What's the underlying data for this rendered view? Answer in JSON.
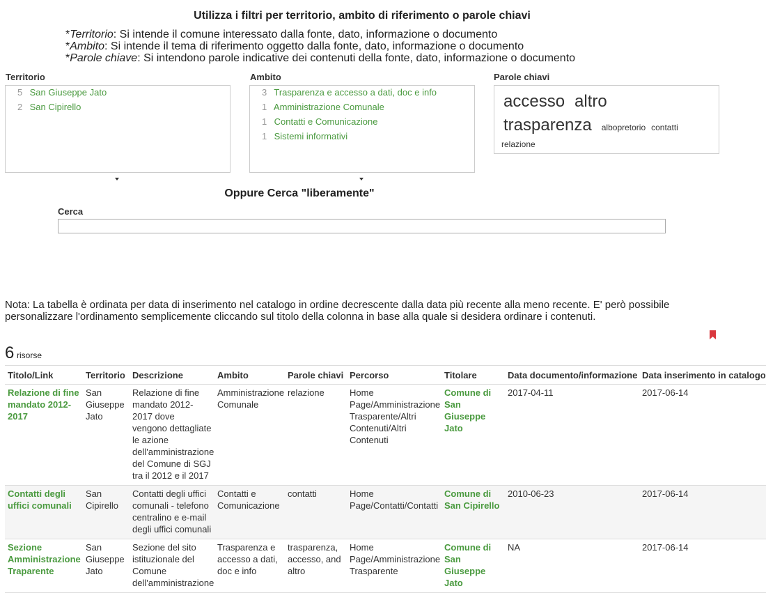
{
  "header": {
    "title": "Utilizza i filtri per territorio, ambito di riferimento o parole chiavi",
    "defs": [
      {
        "term": "Territorio",
        "text": ": Si intende il comune interessato dalla fonte, dato, informazione o documento"
      },
      {
        "term": "Ambito",
        "text": ": Si intende il tema di riferimento oggetto dalla fonte, dato, informazione o documento"
      },
      {
        "term": "Parole chiave",
        "text": ": Si intendono parole indicative dei contenuti della fonte, dato, informazione o documento"
      }
    ]
  },
  "filters": {
    "territorio": {
      "label": "Territorio",
      "items": [
        {
          "count": "5",
          "label": "San Giuseppe Jato"
        },
        {
          "count": "2",
          "label": "San Cipirello"
        }
      ]
    },
    "ambito": {
      "label": "Ambito",
      "items": [
        {
          "count": "3",
          "label": "Trasparenza e accesso a dati, doc e info"
        },
        {
          "count": "1",
          "label": "Amministrazione Comunale"
        },
        {
          "count": "1",
          "label": "Contatti e Comunicazione"
        },
        {
          "count": "1",
          "label": "Sistemi informativi"
        }
      ]
    },
    "parole": {
      "label": "Parole chiavi",
      "tags": [
        "accesso",
        "altro",
        "trasparenza",
        "albopretorio",
        "contatti",
        "relazione"
      ]
    }
  },
  "search": {
    "heading": "Oppure Cerca \"liberamente\"",
    "label": "Cerca",
    "value": "",
    "placeholder": ""
  },
  "nota": "Nota: La tabella è ordinata per data di inserimento nel catalogo in ordine decrescente dalla data più recente alla meno recente. E' però possibile personalizzare l'ordinamento semplicemente cliccando sul titolo della colonna in base alla quale si desidera ordinare i contenuti.",
  "results": {
    "count": "6",
    "count_label": "risorse",
    "columns": [
      "Titolo/Link",
      "Territorio",
      "Descrizione",
      "Ambito",
      "Parole chiavi",
      "Percorso",
      "Titolare",
      "Data documento/informazione",
      "Data inserimento in catalogo"
    ],
    "rows": [
      {
        "titolo": "Relazione di fine mandato 2012-2017",
        "territorio": "San Giuseppe Jato",
        "descrizione": "Relazione di fine mandato 2012-2017 dove vengono dettagliate le azione dell'amministrazione del Comune di SGJ tra il 2012 e il 2017",
        "ambito": "Amministrazione Comunale",
        "parole": "relazione",
        "percorso": "Home Page/Amministrazione Trasparente/Altri Contenuti/Altri Contenuti",
        "titolare": "Comune di San Giuseppe Jato",
        "data_doc": "2017-04-11",
        "data_ins": "2017-06-14"
      },
      {
        "titolo": "Contatti degli uffici comunali",
        "territorio": "San Cipirello",
        "descrizione": "Contatti degli uffici comunali - telefono centralino e e-mail degli uffici comunali",
        "ambito": "Contatti e Comunicazione",
        "parole": "contatti",
        "percorso": "Home Page/Contatti/Contatti",
        "titolare": "Comune di San Cipirello",
        "data_doc": "2010-06-23",
        "data_ins": "2017-06-14"
      },
      {
        "titolo": "Sezione Amministrazione Traparente",
        "territorio": "San Giuseppe Jato",
        "descrizione": "Sezione del sito istituzionale del Comune dell'amministrazione",
        "ambito": "Trasparenza e accesso a dati, doc e info",
        "parole": "trasparenza, accesso, and altro",
        "percorso": "Home Page/Amministrazione Trasparente",
        "titolare": "Comune di San Giuseppe Jato",
        "data_doc": "NA",
        "data_ins": "2017-06-14"
      }
    ]
  },
  "colors": {
    "link": "#4a9a3f",
    "bookmark": "#d9383e",
    "border": "#dddddd"
  },
  "icons": {
    "bookmark": "bookmark-icon",
    "dropdown": "caret-down-icon"
  }
}
